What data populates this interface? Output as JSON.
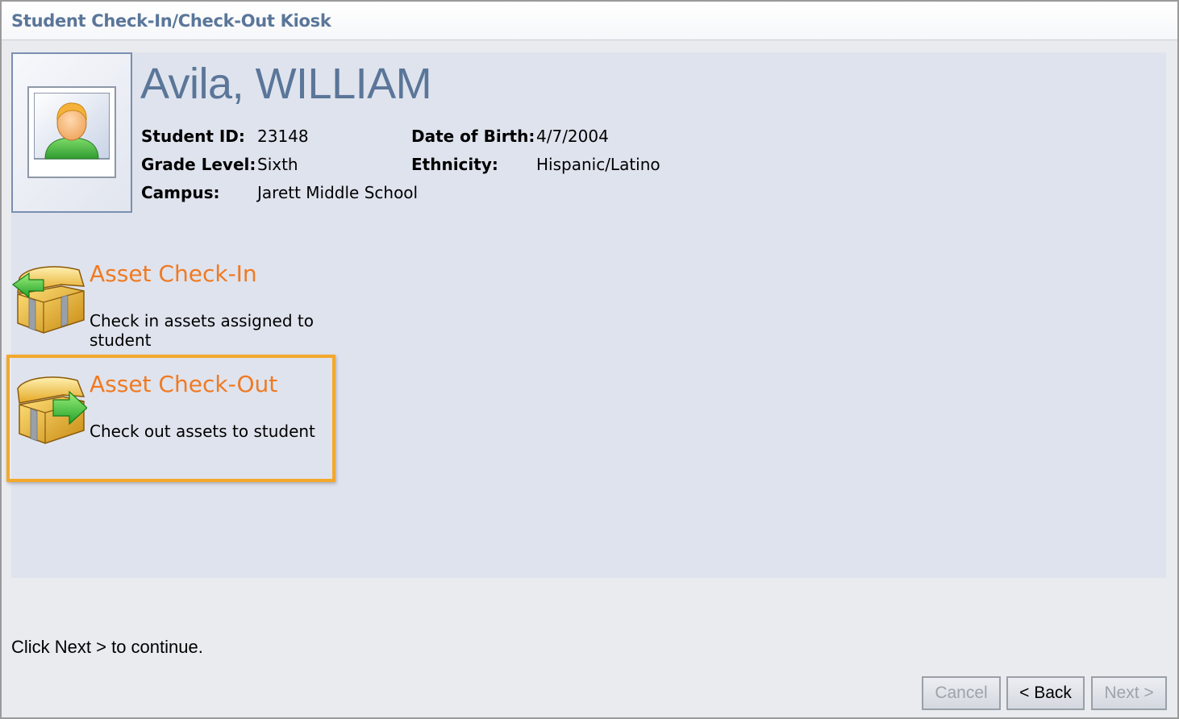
{
  "window": {
    "title": "Student Check-In/Check-Out Kiosk"
  },
  "student": {
    "name": "Avila, WILLIAM",
    "fields": {
      "student_id_label": "Student ID:",
      "student_id": "23148",
      "grade_level_label": "Grade Level:",
      "grade_level": "Sixth",
      "campus_label": "Campus:",
      "campus": "Jarett Middle School",
      "dob_label": "Date of Birth:",
      "dob": "4/7/2004",
      "ethnicity_label": "Ethnicity:",
      "ethnicity": "Hispanic/Latino"
    }
  },
  "options": [
    {
      "title": "Asset Check-In",
      "description": "Check in assets assigned to student",
      "icon": "chest-check-in-icon",
      "selected": false
    },
    {
      "title": "Asset Check-Out",
      "description": "Check out assets to student",
      "icon": "chest-check-out-icon",
      "selected": true
    }
  ],
  "footer": {
    "instruction": "Click Next > to continue.",
    "cancel_label": "Cancel",
    "back_label": "< Back",
    "next_label": "Next >"
  },
  "colors": {
    "title_blue": "#5a7699",
    "option_orange": "#f07a22",
    "selection_border": "#f3a82c",
    "panel_bg": "#dfe3ed"
  }
}
